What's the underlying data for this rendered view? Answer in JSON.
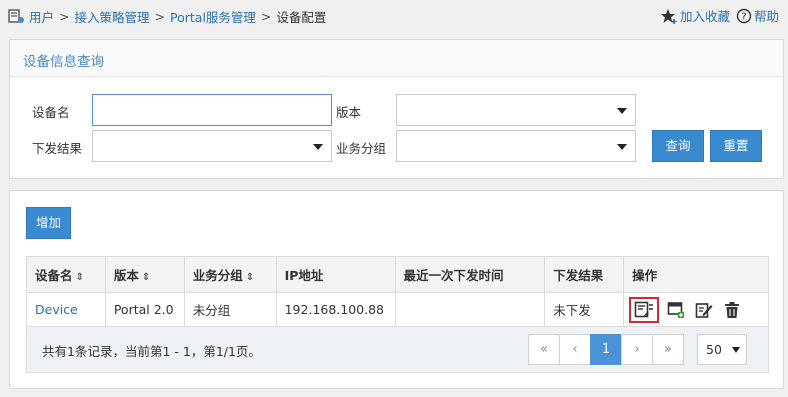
{
  "breadcrumb": {
    "items": [
      "用户",
      "接入策略管理",
      "Portal服务管理"
    ],
    "separator": ">",
    "current": "设备配置"
  },
  "top_actions": {
    "favorite_label": "加入收藏",
    "help_label": "帮助"
  },
  "query": {
    "title": "设备信息查询",
    "device_name_label": "设备名",
    "device_name_value": "",
    "version_label": "版本",
    "version_value": "",
    "result_label": "下发结果",
    "result_value": "",
    "group_label": "业务分组",
    "group_value": "",
    "search_button": "查询",
    "reset_button": "重置"
  },
  "list": {
    "add_button": "增加",
    "columns": [
      "设备名",
      "版本",
      "业务分组",
      "IP地址",
      "最近一次下发时间",
      "下发结果",
      "操作"
    ],
    "sortable": [
      true,
      true,
      true,
      false,
      false,
      false,
      false
    ],
    "rows": [
      {
        "name": "Device",
        "version": "Portal 2.0",
        "group": "未分组",
        "ip": "192.168.100.88",
        "last_time": "",
        "result": "未下发"
      }
    ],
    "summary": "共有1条记录，当前第1 - 1，第1/1页。",
    "pager": {
      "first": "«",
      "prev": "‹",
      "page": "1",
      "next": "›",
      "last": "»"
    },
    "page_size": "50"
  },
  "colors": {
    "link": "#2c6fad",
    "primary": "#3a8ad0",
    "highlight_border": "#d42a2a"
  },
  "icons": [
    "user-config-icon",
    "star-icon",
    "help-icon",
    "deploy-config-icon",
    "device-template-icon",
    "edit-icon",
    "delete-icon"
  ]
}
